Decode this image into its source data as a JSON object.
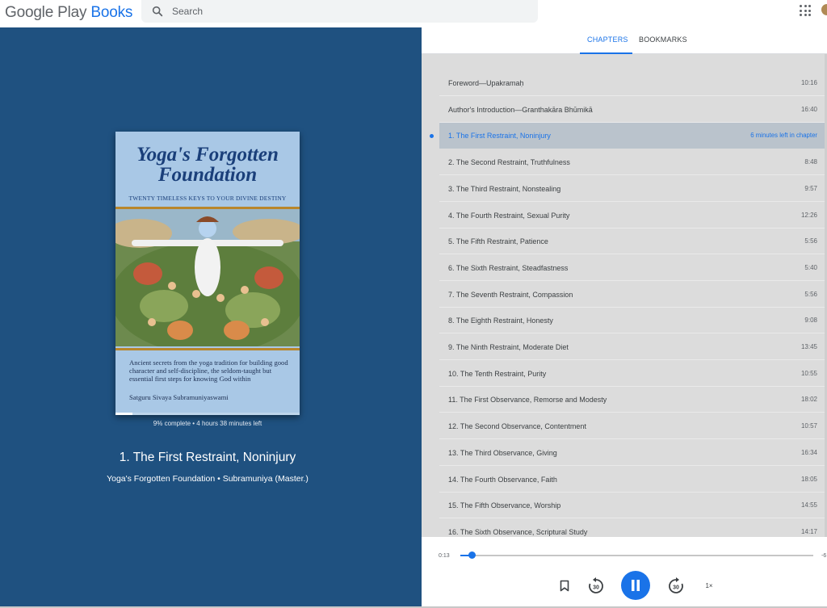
{
  "brand": {
    "google": "Google Play",
    "books": "Books"
  },
  "search": {
    "placeholder": "Search"
  },
  "tabs": {
    "chapters": "CHAPTERS",
    "bookmarks": "BOOKMARKS"
  },
  "cover": {
    "title": "Yoga's Forgotten\nFoundation",
    "subtitle": "TWENTY TIMELESS KEYS TO YOUR DIVINE DESTINY",
    "blurb": "Ancient secrets from the yoga tradition for building good character and self-discipline, the seldom-taught but essential first steps for knowing God within",
    "author": "Satguru Sivaya Subramuniyaswami"
  },
  "reading": {
    "progress_fraction": 0.09,
    "progress_text": "9% complete • 4 hours 38 minutes left"
  },
  "now_playing": {
    "title": "1. The First Restraint, Noninjury",
    "subtitle": "Yoga's Forgotten Foundation • Subramuniya (Master.)"
  },
  "chapters": [
    {
      "title": "Foreword—Upakramaḥ",
      "duration": "10:16",
      "active": false
    },
    {
      "title": "Author's Introduction—Granthakāra Bhūmikā",
      "duration": "16:40",
      "active": false
    },
    {
      "title": "1. The First Restraint, Noninjury",
      "duration": "6 minutes left in chapter",
      "active": true
    },
    {
      "title": "2. The Second Restraint, Truthfulness",
      "duration": "8:48",
      "active": false
    },
    {
      "title": "3. The Third Restraint, Nonstealing",
      "duration": "9:57",
      "active": false
    },
    {
      "title": "4. The Fourth Restraint, Sexual Purity",
      "duration": "12:26",
      "active": false
    },
    {
      "title": "5. The Fifth Restraint, Patience",
      "duration": "5:56",
      "active": false
    },
    {
      "title": "6. The Sixth Restraint, Steadfastness",
      "duration": "5:40",
      "active": false
    },
    {
      "title": "7. The Seventh Restraint, Compassion",
      "duration": "5:56",
      "active": false
    },
    {
      "title": "8. The Eighth Restraint, Honesty",
      "duration": "9:08",
      "active": false
    },
    {
      "title": "9. The Ninth Restraint, Moderate Diet",
      "duration": "13:45",
      "active": false
    },
    {
      "title": "10. The Tenth Restraint, Purity",
      "duration": "10:55",
      "active": false
    },
    {
      "title": "11. The First Observance, Remorse and Modesty",
      "duration": "18:02",
      "active": false
    },
    {
      "title": "12. The Second Observance, Contentment",
      "duration": "10:57",
      "active": false
    },
    {
      "title": "13. The Third Observance, Giving",
      "duration": "16:34",
      "active": false
    },
    {
      "title": "14. The Fourth Observance, Faith",
      "duration": "18:05",
      "active": false
    },
    {
      "title": "15. The Fifth Observance, Worship",
      "duration": "14:55",
      "active": false
    },
    {
      "title": "16. The Sixth Observance, Scriptural Study",
      "duration": "14:17",
      "active": false
    }
  ],
  "player": {
    "elapsed": "0:13",
    "remaining": "-6",
    "position_fraction": 0.03,
    "rewind_seconds": "30",
    "forward_seconds": "30",
    "speed": "1×"
  },
  "colors": {
    "accent": "#1a73e8",
    "left_panel": "#1f5180",
    "list_bg": "#dcdcdc",
    "active_row": "#bac3cc"
  },
  "icons": {
    "search": "search-icon",
    "apps": "apps-grid-icon",
    "bookmark": "bookmark-icon",
    "rewind": "replay-30-icon",
    "forward": "forward-30-icon",
    "pause": "pause-icon"
  }
}
